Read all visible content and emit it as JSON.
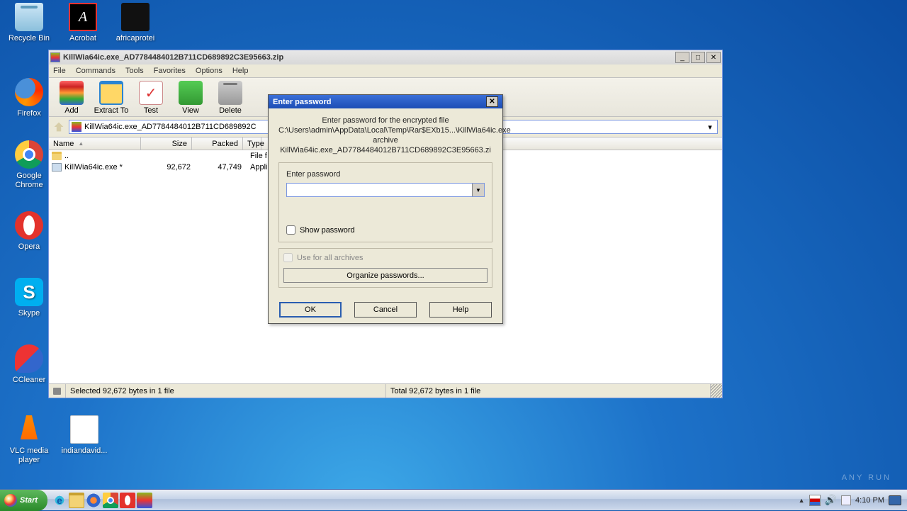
{
  "desktop_icons": {
    "recycle": "Recycle Bin",
    "acrobat": "Acrobat",
    "africaprotei": "africaprotei",
    "firefox": "Firefox",
    "chrome": "Google Chrome",
    "opera": "Opera",
    "skype": "Skype",
    "ccleaner": "CCleaner",
    "vlc": "VLC media player",
    "indiandavid": "indiandavid..."
  },
  "winrar": {
    "title": "KillWia64ic.exe_AD7784484012B711CD689892C3E95663.zip",
    "menu": {
      "file": "File",
      "commands": "Commands",
      "tools": "Tools",
      "favorites": "Favorites",
      "options": "Options",
      "help": "Help"
    },
    "toolbar": {
      "add": "Add",
      "extract": "Extract To",
      "test": "Test",
      "view": "View",
      "delete": "Delete"
    },
    "path": "KillWia64ic.exe_AD7784484012B711CD689892C",
    "columns": {
      "name": "Name",
      "size": "Size",
      "packed": "Packed",
      "type": "Type"
    },
    "rows": [
      {
        "name": "..",
        "size": "",
        "packed": "",
        "type": "File f"
      },
      {
        "name": "KillWia64ic.exe *",
        "size": "92,672",
        "packed": "47,749",
        "type": "Appli"
      }
    ],
    "status": {
      "selected": "Selected 92,672 bytes in 1 file",
      "total": "Total 92,672 bytes in 1 file"
    }
  },
  "dialog": {
    "title": "Enter password",
    "msg1": "Enter password for the encrypted file",
    "msg2": "C:\\Users\\admin\\AppData\\Local\\Temp\\Rar$EXb15...\\KillWia64ic.exe",
    "msg3": "archive KillWia64ic.exe_AD7784484012B711CD689892C3E95663.zi",
    "enter_label": "Enter password",
    "password_value": "",
    "show_pw": "Show password",
    "use_all": "Use for all archives",
    "organize": "Organize passwords...",
    "ok": "OK",
    "cancel": "Cancel",
    "help": "Help"
  },
  "taskbar": {
    "start": "Start",
    "clock": "4:10 PM"
  },
  "watermark": "ANY    RUN"
}
